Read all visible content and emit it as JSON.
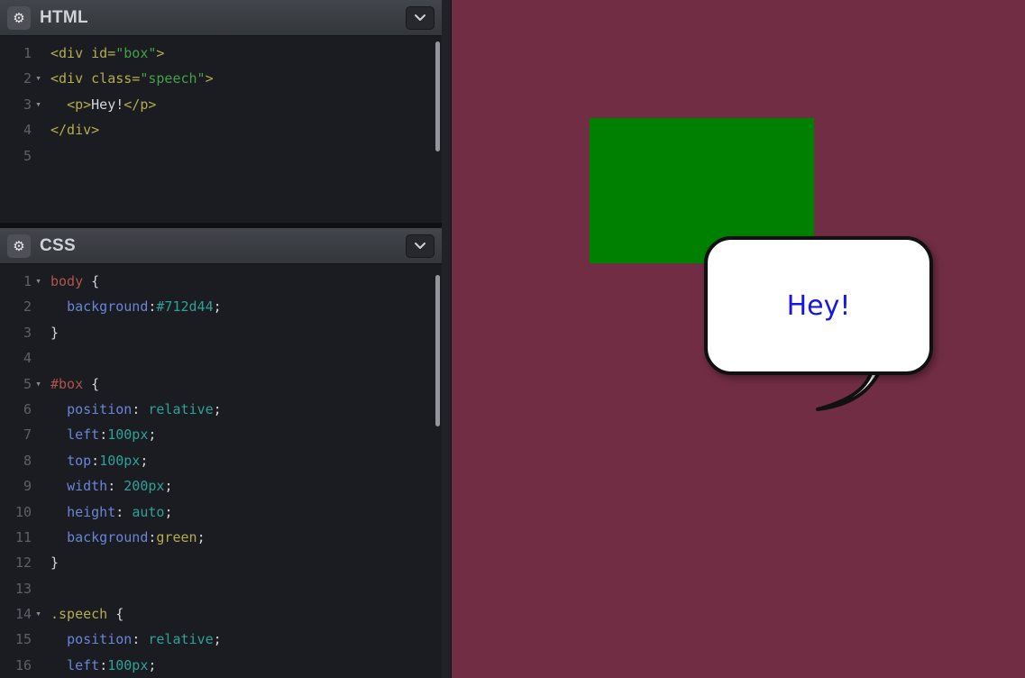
{
  "editors": [
    {
      "id": "html",
      "title": "HTML",
      "lines": [
        {
          "n": "1",
          "fold": false,
          "segs": [
            [
              "tag",
              "<div "
            ],
            [
              "attr",
              "id="
            ],
            [
              "str",
              "\"box\""
            ],
            [
              "tag",
              ">"
            ]
          ]
        },
        {
          "n": "2",
          "fold": true,
          "segs": [
            [
              "tag",
              "<div "
            ],
            [
              "attr",
              "class="
            ],
            [
              "str",
              "\"speech\""
            ],
            [
              "tag",
              ">"
            ]
          ]
        },
        {
          "n": "3",
          "fold": true,
          "segs": [
            [
              "plain",
              "  "
            ],
            [
              "tag",
              "<p>"
            ],
            [
              "plain",
              "Hey!"
            ],
            [
              "tag",
              "</p>"
            ]
          ]
        },
        {
          "n": "4",
          "fold": false,
          "segs": [
            [
              "tag",
              "</div>"
            ]
          ]
        },
        {
          "n": "5",
          "fold": false,
          "segs": []
        }
      ]
    },
    {
      "id": "css",
      "title": "CSS",
      "lines": [
        {
          "n": "1",
          "fold": true,
          "segs": [
            [
              "selred",
              "body"
            ],
            [
              "plain",
              " {"
            ]
          ]
        },
        {
          "n": "2",
          "fold": false,
          "segs": [
            [
              "plain",
              "  "
            ],
            [
              "prop",
              "background"
            ],
            [
              "plain",
              ":"
            ],
            [
              "val",
              "#712d44"
            ],
            [
              "plain",
              ";"
            ]
          ]
        },
        {
          "n": "3",
          "fold": false,
          "segs": [
            [
              "plain",
              "}"
            ]
          ]
        },
        {
          "n": "4",
          "fold": false,
          "segs": []
        },
        {
          "n": "5",
          "fold": true,
          "segs": [
            [
              "selred",
              "#box"
            ],
            [
              "plain",
              " {"
            ]
          ]
        },
        {
          "n": "6",
          "fold": false,
          "segs": [
            [
              "plain",
              "  "
            ],
            [
              "prop",
              "position"
            ],
            [
              "plain",
              ": "
            ],
            [
              "val",
              "relative"
            ],
            [
              "plain",
              ";"
            ]
          ]
        },
        {
          "n": "7",
          "fold": false,
          "segs": [
            [
              "plain",
              "  "
            ],
            [
              "prop",
              "left"
            ],
            [
              "plain",
              ":"
            ],
            [
              "val",
              "100px"
            ],
            [
              "plain",
              ";"
            ]
          ]
        },
        {
          "n": "8",
          "fold": false,
          "segs": [
            [
              "plain",
              "  "
            ],
            [
              "prop",
              "top"
            ],
            [
              "plain",
              ":"
            ],
            [
              "val",
              "100px"
            ],
            [
              "plain",
              ";"
            ]
          ]
        },
        {
          "n": "9",
          "fold": false,
          "segs": [
            [
              "plain",
              "  "
            ],
            [
              "prop",
              "width"
            ],
            [
              "plain",
              ": "
            ],
            [
              "val",
              "200px"
            ],
            [
              "plain",
              ";"
            ]
          ]
        },
        {
          "n": "10",
          "fold": false,
          "segs": [
            [
              "plain",
              "  "
            ],
            [
              "prop",
              "height"
            ],
            [
              "plain",
              ": "
            ],
            [
              "val",
              "auto"
            ],
            [
              "plain",
              ";"
            ]
          ]
        },
        {
          "n": "11",
          "fold": false,
          "segs": [
            [
              "plain",
              "  "
            ],
            [
              "prop",
              "background"
            ],
            [
              "plain",
              ":"
            ],
            [
              "kw",
              "green"
            ],
            [
              "plain",
              ";"
            ]
          ]
        },
        {
          "n": "12",
          "fold": false,
          "segs": [
            [
              "plain",
              "}"
            ]
          ]
        },
        {
          "n": "13",
          "fold": false,
          "segs": []
        },
        {
          "n": "14",
          "fold": true,
          "segs": [
            [
              "selyel",
              ".speech"
            ],
            [
              "plain",
              " {"
            ]
          ]
        },
        {
          "n": "15",
          "fold": false,
          "segs": [
            [
              "plain",
              "  "
            ],
            [
              "prop",
              "position"
            ],
            [
              "plain",
              ": "
            ],
            [
              "val",
              "relative"
            ],
            [
              "plain",
              ";"
            ]
          ]
        },
        {
          "n": "16",
          "fold": false,
          "segs": [
            [
              "plain",
              "  "
            ],
            [
              "prop",
              "left"
            ],
            [
              "plain",
              ":"
            ],
            [
              "val",
              "100px"
            ],
            [
              "plain",
              ";"
            ]
          ]
        }
      ]
    }
  ],
  "icons": {
    "gear": "⚙",
    "fold_arrow": "▾"
  },
  "preview": {
    "bubble_text": "Hey!",
    "colors": {
      "page_background": "#712d44",
      "box_fill": "green",
      "bubble_fill": "#ffffff",
      "bubble_border": "#111111",
      "bubble_text": "#1616e6"
    }
  }
}
